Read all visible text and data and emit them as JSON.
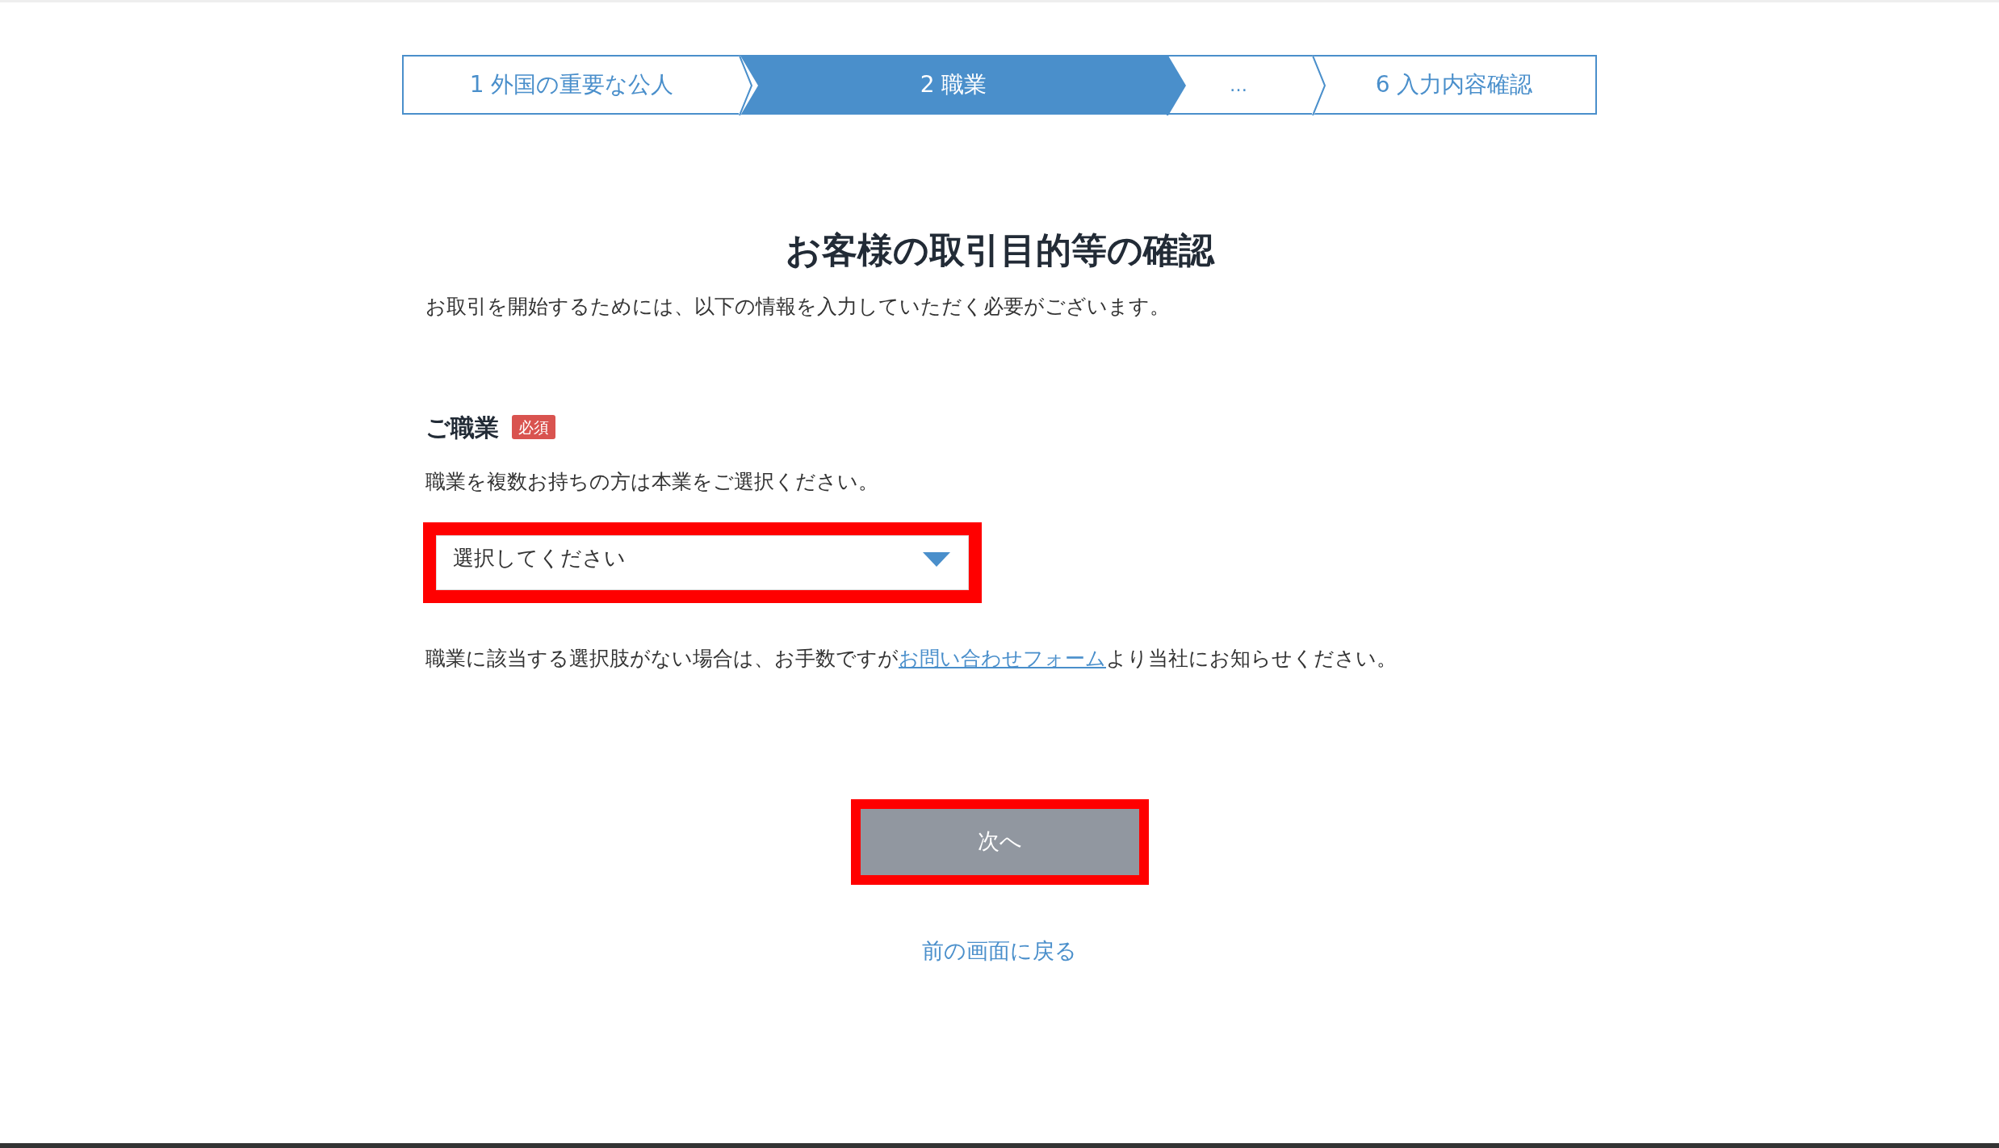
{
  "steps": [
    {
      "kind": "step",
      "label": "1 外国の重要な公人",
      "selected": false
    },
    {
      "kind": "step",
      "label": "2 職業",
      "selected": true
    },
    {
      "kind": "ellipsis",
      "label": "…",
      "selected": false
    },
    {
      "kind": "step",
      "label": "6 入力内容確認",
      "selected": false
    }
  ],
  "title": "お客様の取引目的等の確認",
  "intro": "お取引を開始するためには、以下の情報を入力していただく必要がございます。",
  "field": {
    "label": "ご職業",
    "badge": "必須",
    "hint": "職業を複数お持ちの方は本業をご選択ください。",
    "placeholder": "選択してください",
    "highlighted": true
  },
  "note": {
    "before": "職業に該当する選択肢がない場合は、お手数ですが",
    "link": "お問い合わせフォーム",
    "after": "より当社にお知らせください。"
  },
  "next_button": {
    "label": "次へ",
    "disabled": true,
    "highlighted": true
  },
  "back_link": "前の画面に戻る"
}
